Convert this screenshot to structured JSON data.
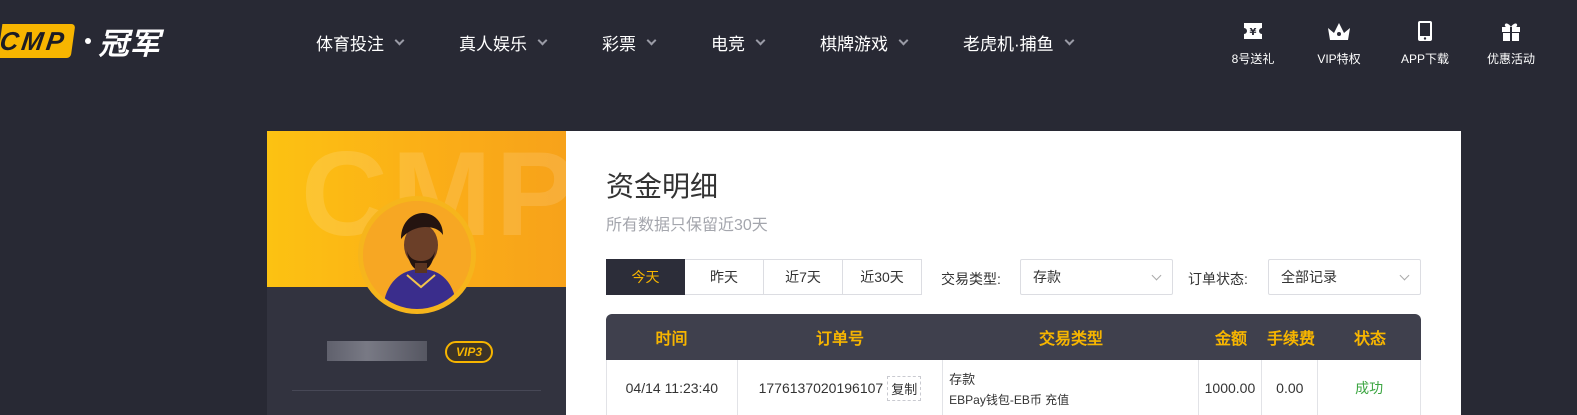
{
  "logo": {
    "brand_letters": "CMP",
    "brand_name": "冠军"
  },
  "nav": [
    {
      "label": "体育投注"
    },
    {
      "label": "真人娱乐"
    },
    {
      "label": "彩票"
    },
    {
      "label": "电竞"
    },
    {
      "label": "棋牌游戏"
    },
    {
      "label": "老虎机·捕鱼"
    }
  ],
  "tools": [
    {
      "label": "8号送礼",
      "icon": "ticket-icon"
    },
    {
      "label": "VIP特权",
      "icon": "crown-icon"
    },
    {
      "label": "APP下载",
      "icon": "phone-icon"
    },
    {
      "label": "优惠活动",
      "icon": "gift-icon"
    }
  ],
  "profile": {
    "watermark": "CMP",
    "vip_level": "VIP3"
  },
  "main": {
    "title": "资金明细",
    "subtitle": "所有数据只保留近30天",
    "date_tabs": [
      {
        "label": "今天",
        "active": true
      },
      {
        "label": "昨天"
      },
      {
        "label": "近7天"
      },
      {
        "label": "近30天"
      }
    ],
    "trade_type_label": "交易类型:",
    "trade_type_value": "存款",
    "order_status_label": "订单状态:",
    "order_status_value": "全部记录"
  },
  "table": {
    "headers": [
      "时间",
      "订单号",
      "交易类型",
      "金额",
      "手续费",
      "状态"
    ],
    "rows": [
      {
        "time": "04/14 11:23:40",
        "order_no": "1776137020196107",
        "copy_label": "复制",
        "type": "存款",
        "type_detail": "EBPay钱包-EB币 充值",
        "amount": "1000.00",
        "fee": "0.00",
        "status": "成功"
      }
    ]
  },
  "colors": {
    "accent": "#f7b500",
    "header_bg": "#282934",
    "success": "#3ca642"
  }
}
